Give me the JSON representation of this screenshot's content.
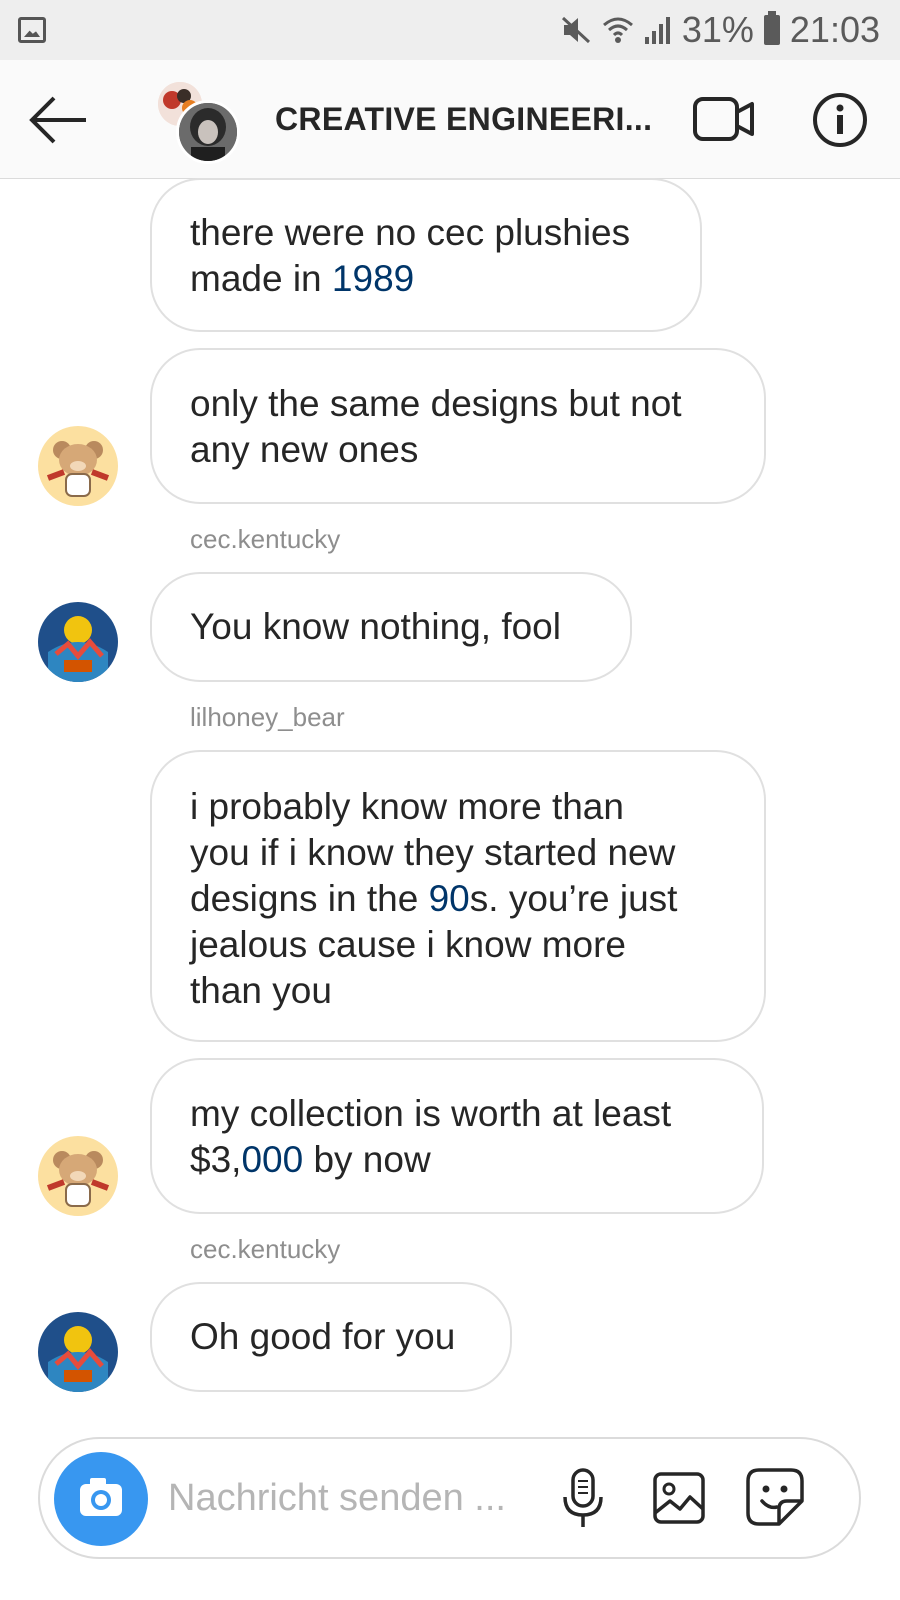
{
  "status_bar": {
    "battery": "31%",
    "time": "21:03"
  },
  "header": {
    "title": "CREATIVE ENGINEERI..."
  },
  "messages": [
    {
      "text_parts": [
        "there were no cec plushies",
        "made in ",
        "1989"
      ]
    },
    {
      "text_parts": [
        "only the same designs but not",
        "any new ones"
      ]
    },
    {
      "sender": "cec.kentucky"
    },
    {
      "text_parts": [
        "You know nothing, fool"
      ]
    },
    {
      "sender": "lilhoney_bear"
    },
    {
      "text_parts": [
        "i probably know more than",
        "you if i know they started new",
        "designs in the ",
        "90",
        "s. you’re just",
        "jealous cause i know more",
        "than you"
      ]
    },
    {
      "text_parts": [
        "my collection is worth at least",
        "$3,",
        "000",
        " by now"
      ]
    },
    {
      "sender": "cec.kentucky"
    },
    {
      "text_parts": [
        "Oh good for you"
      ]
    }
  ],
  "composer": {
    "placeholder": "Nachricht senden ..."
  },
  "colors": {
    "accent_blue": "#3897f0",
    "link_number": "#003569",
    "bubble_border": "#e0e0e0"
  },
  "icons": [
    "gallery-icon",
    "mute-icon",
    "wifi-icon",
    "signal-icon",
    "battery-icon",
    "back-arrow-icon",
    "video-call-icon",
    "info-icon",
    "camera-icon",
    "microphone-icon",
    "image-icon",
    "sticker-icon"
  ]
}
